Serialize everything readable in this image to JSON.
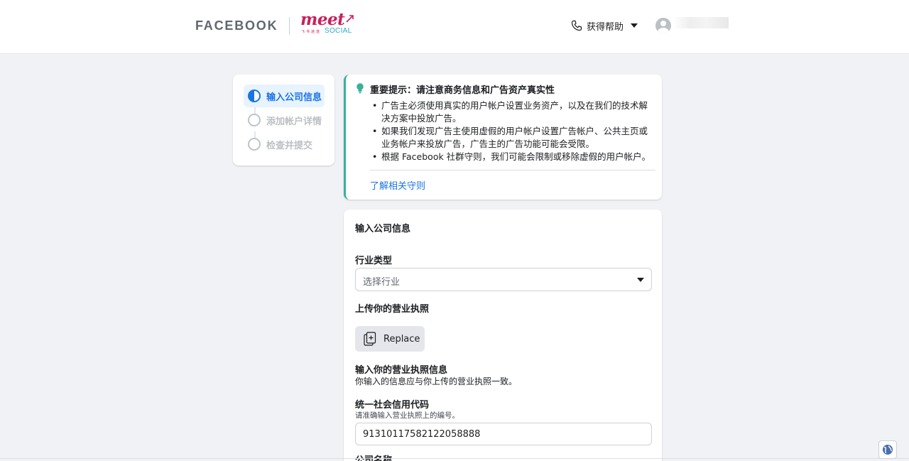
{
  "header": {
    "brand": "FACEBOOK",
    "partner_logo": {
      "main": "meet",
      "sub": "SOCIAL",
      "tagline": "飞书迷途",
      "color": "#c8205a",
      "accent": "#2aa9c7"
    },
    "help_label": "获得帮助",
    "help_icon": "phone-icon",
    "avatar_icon": "user-avatar-icon"
  },
  "steps": [
    {
      "label": "输入公司信息",
      "state": "active"
    },
    {
      "label": "添加帐户详情",
      "state": "pending"
    },
    {
      "label": "检查并提交",
      "state": "pending"
    }
  ],
  "notice": {
    "icon": "lightbulb-icon",
    "accent_color": "#37b29a",
    "title": "重要提示：请注意商务信息和广告资产真实性",
    "items": [
      "广告主必须使用真实的用户帐户设置业务资产，以及在我们的技术解决方案中投放广告。",
      "如果我们发现广告主使用虚假的用户帐户设置广告帐户、公共主页或业务帐户来投放广告，广告主的广告功能可能会受限。",
      "根据 Facebook 社群守则，我们可能会限制或移除虚假的用户帐户。"
    ],
    "link_label": "了解相关守则"
  },
  "form": {
    "title": "输入公司信息",
    "industry": {
      "label": "行业类型",
      "placeholder": "选择行业"
    },
    "license_upload": {
      "label": "上传你的营业执照",
      "button_label": "Replace"
    },
    "license_info": {
      "label": "输入你的营业执照信息",
      "description": "你输入的信息应与你上传的营业执照一致。"
    },
    "credit_code": {
      "label": "统一社会信用代码",
      "hint": "请准确输入营业执照上的编号。",
      "value": "91310117582122058888"
    },
    "next_label": "公司名称"
  },
  "footer": {
    "language_icon": "globe-icon"
  }
}
